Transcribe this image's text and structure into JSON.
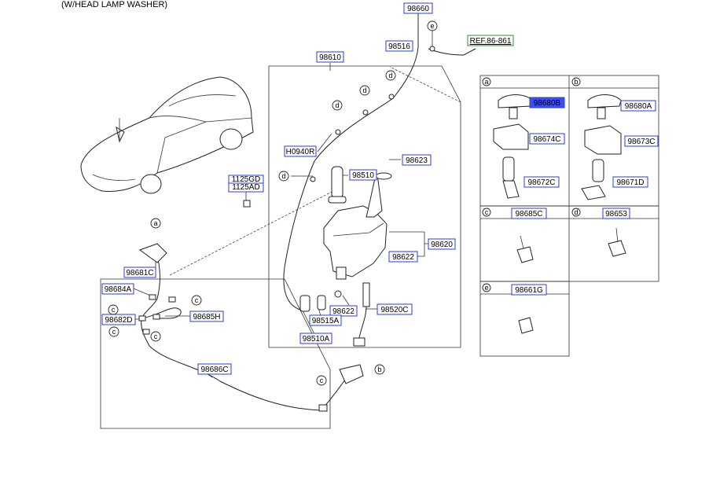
{
  "header": {
    "title": "(W/HEAD LAMP WASHER)"
  },
  "ref": {
    "label": "REF.86-861"
  },
  "labels": {
    "p98660": "98660",
    "p98516": "98516",
    "p98610": "98610",
    "p1125GD": "1125GD",
    "p1125AD": "1125AD",
    "pH0940R": "H0940R",
    "p98510": "98510",
    "p98623": "98623",
    "p98620": "98620",
    "p98622a": "98622",
    "p98622b": "98622",
    "p98520C": "98520C",
    "p98515A": "98515A",
    "p98510A": "98510A",
    "p98681C": "98681C",
    "p98684A": "98684A",
    "p98682D": "98682D",
    "p98685H": "98685H",
    "p98686C": "98686C"
  },
  "detail_panels": {
    "a": {
      "letter": "a",
      "parts": [
        "98680B",
        "98674C",
        "98672C"
      ],
      "selected": "98680B"
    },
    "b": {
      "letter": "b",
      "parts": [
        "98680A",
        "98673C",
        "98671D"
      ]
    },
    "c": {
      "letter": "c",
      "parts": [
        "98685C"
      ]
    },
    "d": {
      "letter": "d",
      "parts": [
        "98653"
      ]
    },
    "e": {
      "letter": "e",
      "parts": [
        "98661G"
      ]
    }
  },
  "callouts": {
    "a": "a",
    "b": "b",
    "c": "c",
    "d": "d",
    "e": "e"
  },
  "colors": {
    "label_border": "#2b3fcf",
    "selected_fill": "#3d4df0",
    "ref_border": "#3a8a3a"
  }
}
